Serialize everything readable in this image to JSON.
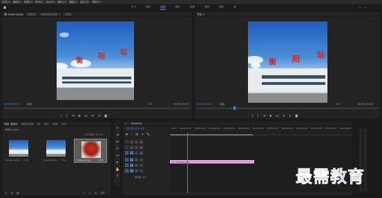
{
  "menubar": [
    "文件(F)",
    "编辑(E)",
    "剪辑(C)",
    "序列(S)",
    "标记(M)",
    "图形(G)",
    "视图(V)",
    "窗口(W)",
    "帮助(H)"
  ],
  "workspaces": {
    "items": [
      "学习",
      "组件",
      "编辑",
      "颜色",
      "效果",
      "音频",
      "图形",
      "库"
    ],
    "active_index": 2
  },
  "source_panel": {
    "tabs": [
      "源: tangerng.jpg",
      "效果控件",
      "音频剪辑混合器: 1",
      "元数据"
    ],
    "timecode_left": "00:00:00:00",
    "fit": "适合",
    "scale": "1/2",
    "timecode_right": "00:00:05:00"
  },
  "program_panel": {
    "tabs": [
      "节目: 1"
    ],
    "timecode_left": "00:00:01:01",
    "fit": "适合",
    "scale": "1/2",
    "timecode_right": "00:00:05:00"
  },
  "photo": {
    "sign_chars": [
      "衡",
      "阳",
      "站"
    ]
  },
  "project_panel": {
    "tabs": [
      "项目: 未命名",
      "媒体浏览器",
      "库",
      "信息",
      "效果",
      "标记"
    ],
    "project_name": "未命名.prproj",
    "items_count": "1 项已选择，共 3 项",
    "items": [
      {
        "label": "tangerng.jpg",
        "duration": "5:00"
      },
      {
        "label": "tangerng.jpg",
        "duration": "5:00"
      },
      {
        "label": "hongjiang.jpg",
        "duration": "5:00"
      }
    ]
  },
  "timeline": {
    "tab": "tangerng",
    "timecode": "00:00:01:01",
    "ruler_labels": [
      "00:00",
      "00:00:01:00",
      "00:00:02:00",
      "00:00:03:00",
      "00:00:04:00",
      "00:00:05:00",
      "00:00:06:00",
      "00:00:07:00",
      "00:00:08:00",
      "00:00:09:00",
      "00:00:10:00",
      "00:00:11:00",
      "00:00:12:00"
    ],
    "tracks": [
      "V3",
      "V2",
      "V1",
      "A1",
      "A2",
      "A3"
    ],
    "master_label": "主声道",
    "master_value": "0.0",
    "clip_label": "hongjiang.jpg"
  },
  "watermark": "最需教育",
  "colors": {
    "accent": "#2f8dea",
    "clip": "#d89ad8",
    "playhead": "#2f8dea"
  }
}
